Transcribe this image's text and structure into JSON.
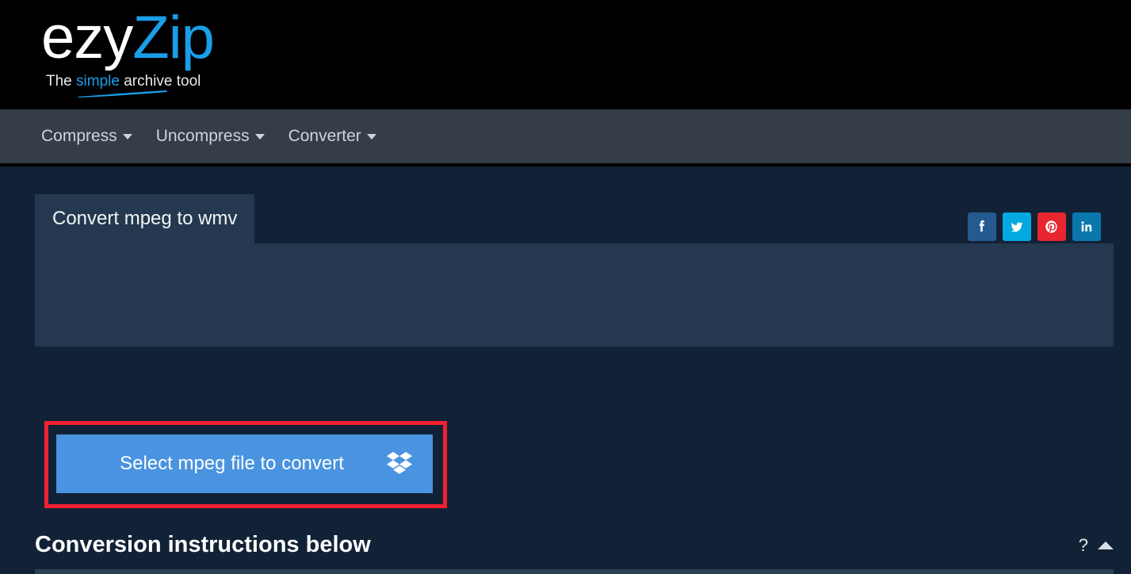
{
  "header": {
    "logo_primary": "ezy",
    "logo_secondary": "Zip",
    "tagline_prefix": "The ",
    "tagline_highlight": "simple",
    "tagline_suffix": " archive tool",
    "brand_color": "#1a9ee8",
    "background_color": "#000000"
  },
  "nav": {
    "items": [
      {
        "label": "Compress",
        "icon": "chevron-down-icon"
      },
      {
        "label": "Uncompress",
        "icon": "chevron-down-icon"
      },
      {
        "label": "Converter",
        "icon": "chevron-down-icon"
      }
    ],
    "background_color": "#343d48"
  },
  "main": {
    "tab": {
      "label": "Convert mpeg to wmv",
      "active": true
    },
    "select_file_button": {
      "label": "Select mpeg file to convert",
      "icon": "dropbox-icon",
      "color": "#4a93e0",
      "highlight_border_color": "#f22030"
    },
    "instructions": {
      "title": "Conversion instructions below",
      "help_icon": "question-mark-icon",
      "collapse_icon": "chevron-up-icon"
    },
    "background_color": "#122236",
    "panel_color": "#24394f"
  },
  "social": {
    "buttons": [
      {
        "name": "facebook",
        "label": "f",
        "color": "#255a91"
      },
      {
        "name": "twitter",
        "label": "",
        "color": "#03a9e0"
      },
      {
        "name": "pinterest",
        "label": "",
        "color": "#e8262f"
      },
      {
        "name": "linkedin",
        "label": "in",
        "color": "#0b77ad"
      }
    ]
  }
}
